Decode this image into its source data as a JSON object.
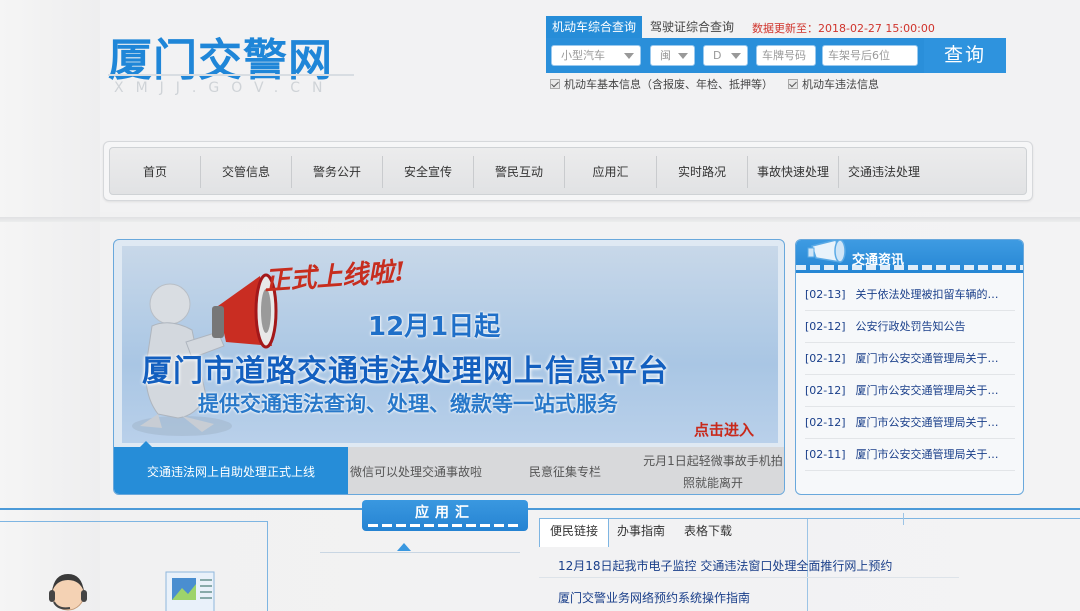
{
  "logo": {
    "title": "厦门交警网",
    "subtitle": "XMJJ.GOV.CN"
  },
  "query": {
    "tabs": [
      {
        "label": "机动车综合查询",
        "active": true
      },
      {
        "label": "驾驶证综合查询",
        "active": false
      }
    ],
    "update_label": "数据更新至：",
    "update_time": "2018-02-27 15:00:00",
    "vehicle_type": "小型汽车",
    "province": "闽",
    "city_letter": "D",
    "plate_placeholder": "车牌号码",
    "vin_placeholder": "车架号后6位",
    "button": "查询",
    "options": [
      {
        "label": "机动车基本信息（含报废、年检、抵押等）",
        "checked": true
      },
      {
        "label": "机动车违法信息",
        "checked": true
      }
    ]
  },
  "nav": {
    "items": [
      "首页",
      "交管信息",
      "警务公开",
      "安全宣传",
      "警民互动",
      "应用汇",
      "实时路况",
      "事故快速处理",
      "交通违法处理"
    ]
  },
  "banner": {
    "headline": "正式上线啦!",
    "date": "12月1日起",
    "title": "厦门市道路交通违法处理网上信息平台",
    "subtitle": "提供交通违法查询、处理、缴款等一站式服务",
    "cta": "点击进入",
    "tabs": [
      "交通违法网上自助处理正式上线",
      "微信可以处理交通事故啦",
      "民意征集专栏",
      "元月1日起轻微事故手机拍照就能离开"
    ]
  },
  "news": {
    "title": "交通资讯",
    "items": [
      {
        "date": "[02-13]",
        "text": "关于依法处理被扣留车辆的…"
      },
      {
        "date": "[02-12]",
        "text": "公安行政处罚告知公告"
      },
      {
        "date": "[02-12]",
        "text": "厦门市公安交通管理局关于…"
      },
      {
        "date": "[02-12]",
        "text": "厦门市公安交通管理局关于…"
      },
      {
        "date": "[02-12]",
        "text": "厦门市公安交通管理局关于…"
      },
      {
        "date": "[02-11]",
        "text": "厦门市公安交通管理局关于…"
      }
    ]
  },
  "apps": {
    "title": "应用汇"
  },
  "links": {
    "tabs": [
      "便民链接",
      "办事指南",
      "表格下载"
    ],
    "items": [
      "12月18日起我市电子监控 交通违法窗口处理全面推行网上预约",
      "厦门交警业务网络预约系统操作指南"
    ]
  },
  "colors": {
    "primary": "#268dd8",
    "alert": "#d0342c",
    "link": "#1a3f8a"
  }
}
